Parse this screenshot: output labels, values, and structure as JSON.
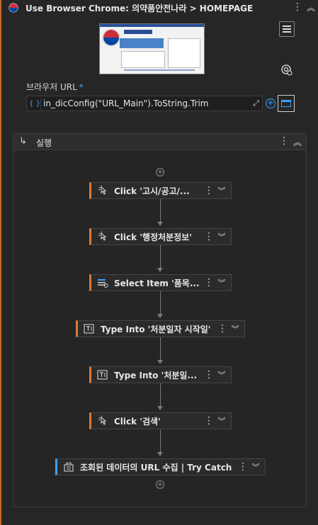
{
  "header": {
    "title": "Use Browser Chrome: 의약품안전나라 > HOMEPAGE",
    "kebab_icon": "vertical-ellipsis-icon",
    "collapse_icon": "chevron-up-double-icon"
  },
  "browser_url": {
    "label": "브라우저 URL",
    "required_mark": "*",
    "brace_label": "{ }",
    "value": "in_dicConfig(\"URL_Main\").ToString.Trim"
  },
  "sequence": {
    "title": "실행",
    "activities": [
      {
        "label": "Click '고시/공고/...",
        "icon": "click-icon"
      },
      {
        "label": "Click '행정처분정보'",
        "icon": "click-icon"
      },
      {
        "label": "Select Item '품목...",
        "icon": "select-item-icon"
      },
      {
        "label": "Type Into '처분일자 시작일'",
        "icon": "type-into-icon"
      },
      {
        "label": "Type Into '처분일...",
        "icon": "type-into-icon"
      },
      {
        "label": "Click '검색'",
        "icon": "click-icon"
      },
      {
        "label": "조회된 데이터의 URL 수집 | Try Catch",
        "icon": "try-catch-icon"
      }
    ]
  },
  "colors": {
    "accent_orange": "#d97a36",
    "accent_blue": "#3ba0ff",
    "background": "#262626"
  }
}
